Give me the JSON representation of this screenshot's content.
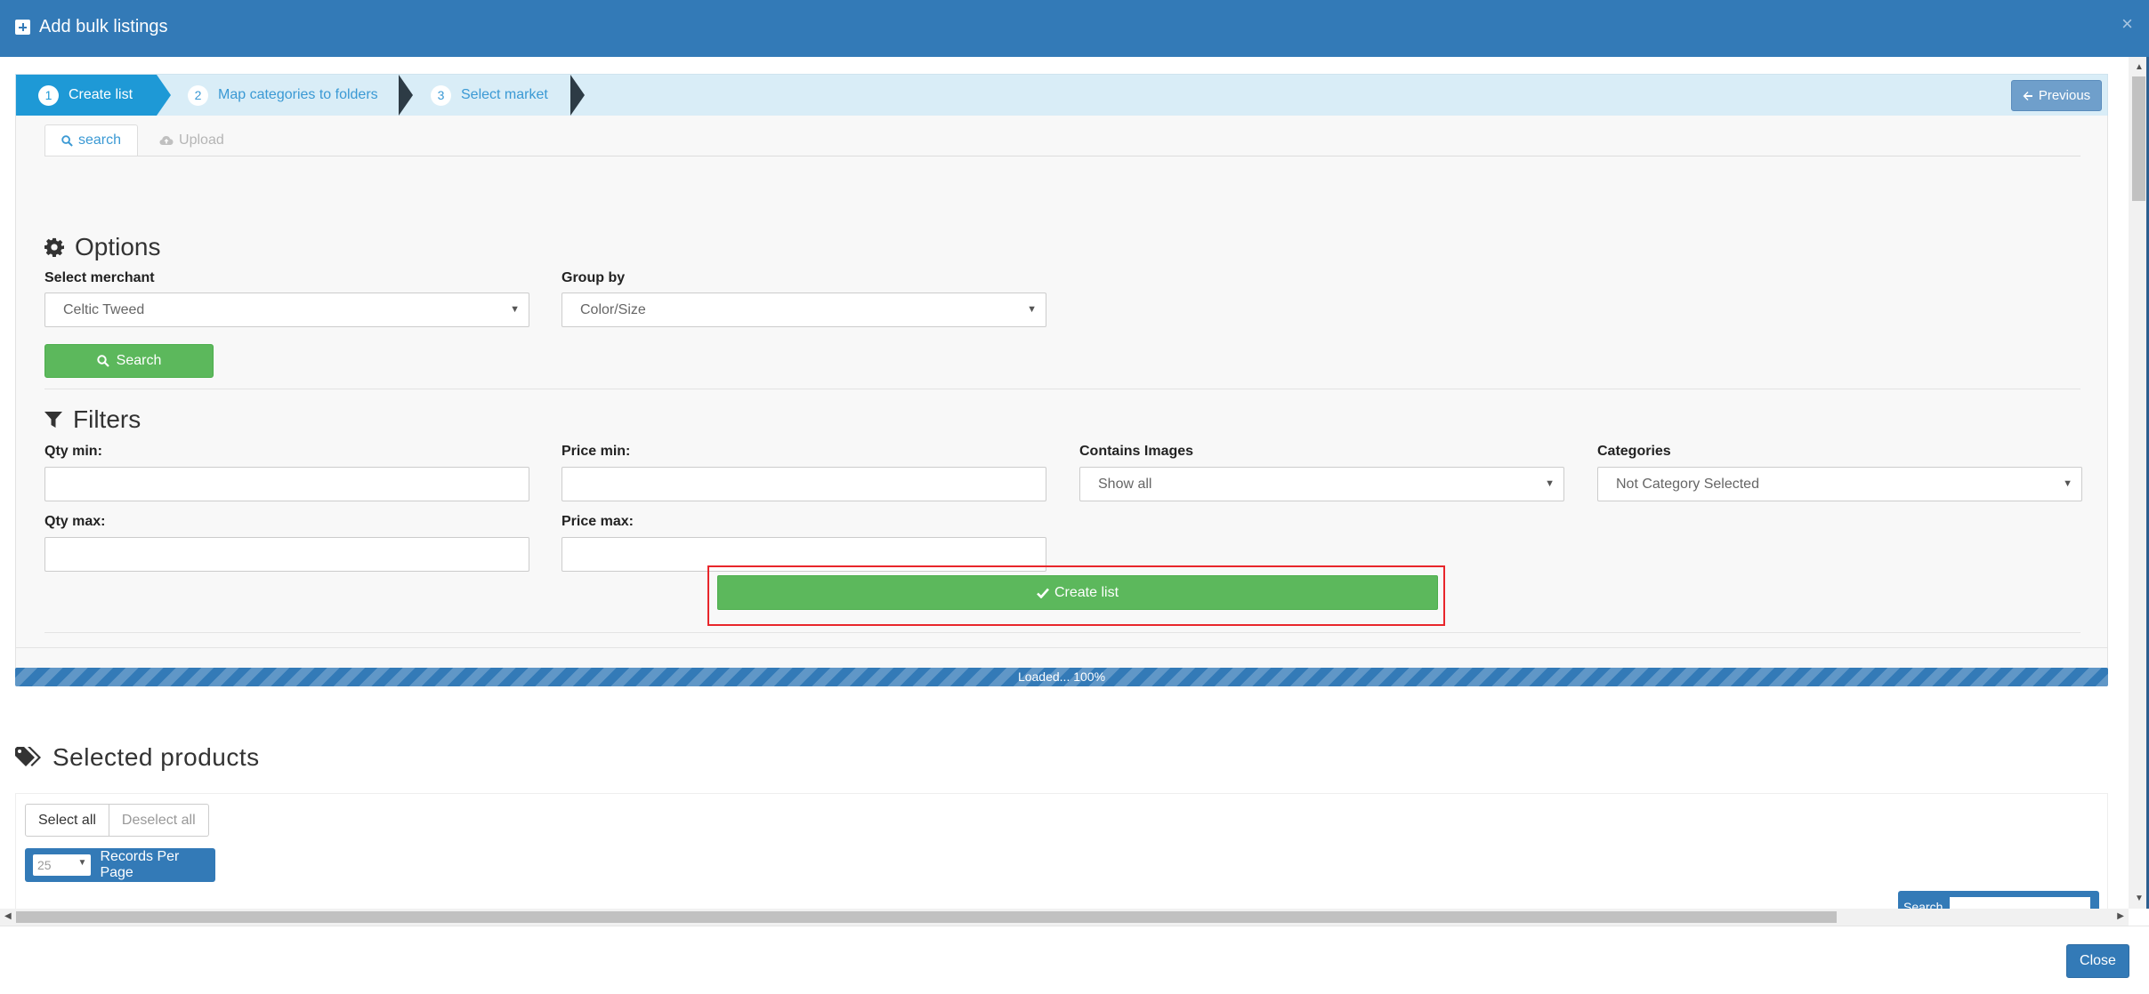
{
  "header": {
    "title": "Add bulk listings",
    "close_symbol": "×"
  },
  "wizard": {
    "steps": [
      {
        "number": "1",
        "label": "Create list"
      },
      {
        "number": "2",
        "label": "Map categories to folders"
      },
      {
        "number": "3",
        "label": "Select market"
      }
    ],
    "previous_label": "Previous"
  },
  "tabs": {
    "search_label": "search",
    "upload_label": "Upload"
  },
  "options": {
    "title": "Options",
    "merchant_label": "Select merchant",
    "merchant_value": "Celtic Tweed",
    "groupby_label": "Group by",
    "groupby_value": "Color/Size",
    "search_button": "Search"
  },
  "filters": {
    "title": "Filters",
    "qty_min_label": "Qty min:",
    "qty_max_label": "Qty max:",
    "price_min_label": "Price min:",
    "price_max_label": "Price max:",
    "images_label": "Contains Images",
    "images_value": "Show all",
    "categories_label": "Categories",
    "categories_value": "Not Category Selected"
  },
  "create_button": "Create list",
  "progress": {
    "text": "Loaded... 100%",
    "percent": 100
  },
  "products": {
    "title": "Selected products",
    "select_all": "Select all",
    "deselect_all": "Deselect all",
    "records_value": "25",
    "records_label": "Records Per Page",
    "search_label": "Search"
  },
  "footer": {
    "close_label": "Close"
  },
  "colors": {
    "primary": "#337ab7",
    "success": "#5cb85c",
    "wizard_active": "#1e99d6",
    "highlight": "#e8262b"
  }
}
